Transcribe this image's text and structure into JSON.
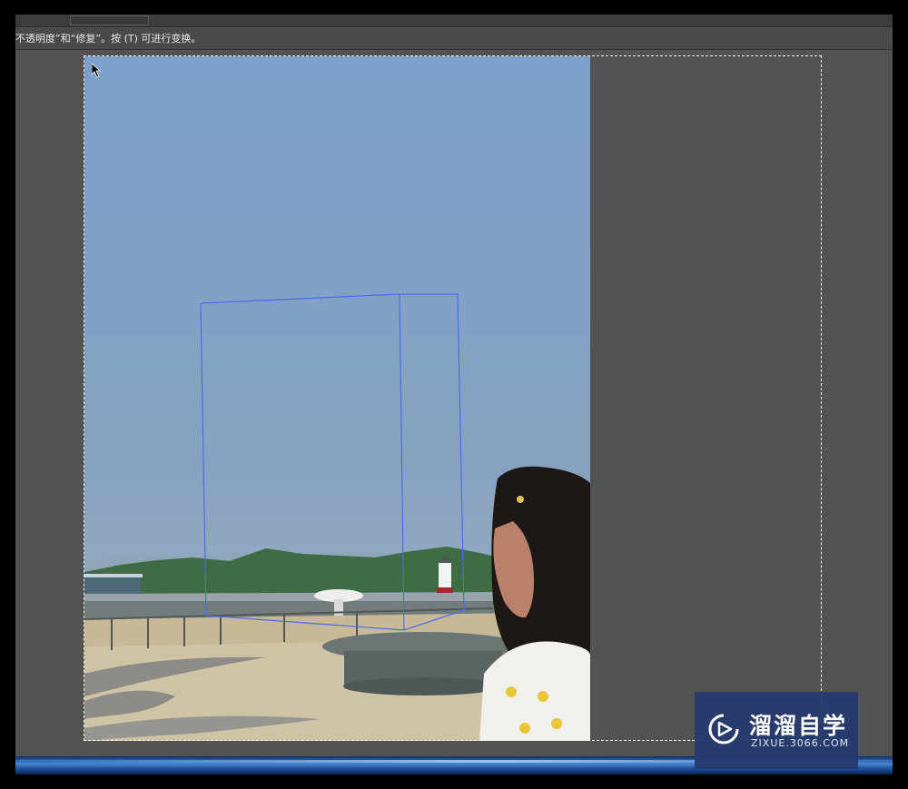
{
  "options_bar": {
    "hint": "不透明度”和“修复”。按 (T) 可进行变换。"
  },
  "watermark": {
    "title": "溜溜自学",
    "subtitle": "ZIXUE.3066.COM"
  },
  "colors": {
    "sky": "#7ea0c4",
    "selection_outline": "#4a6cf0",
    "workspace": "#535353",
    "watermark_bg": "#253a6e"
  }
}
